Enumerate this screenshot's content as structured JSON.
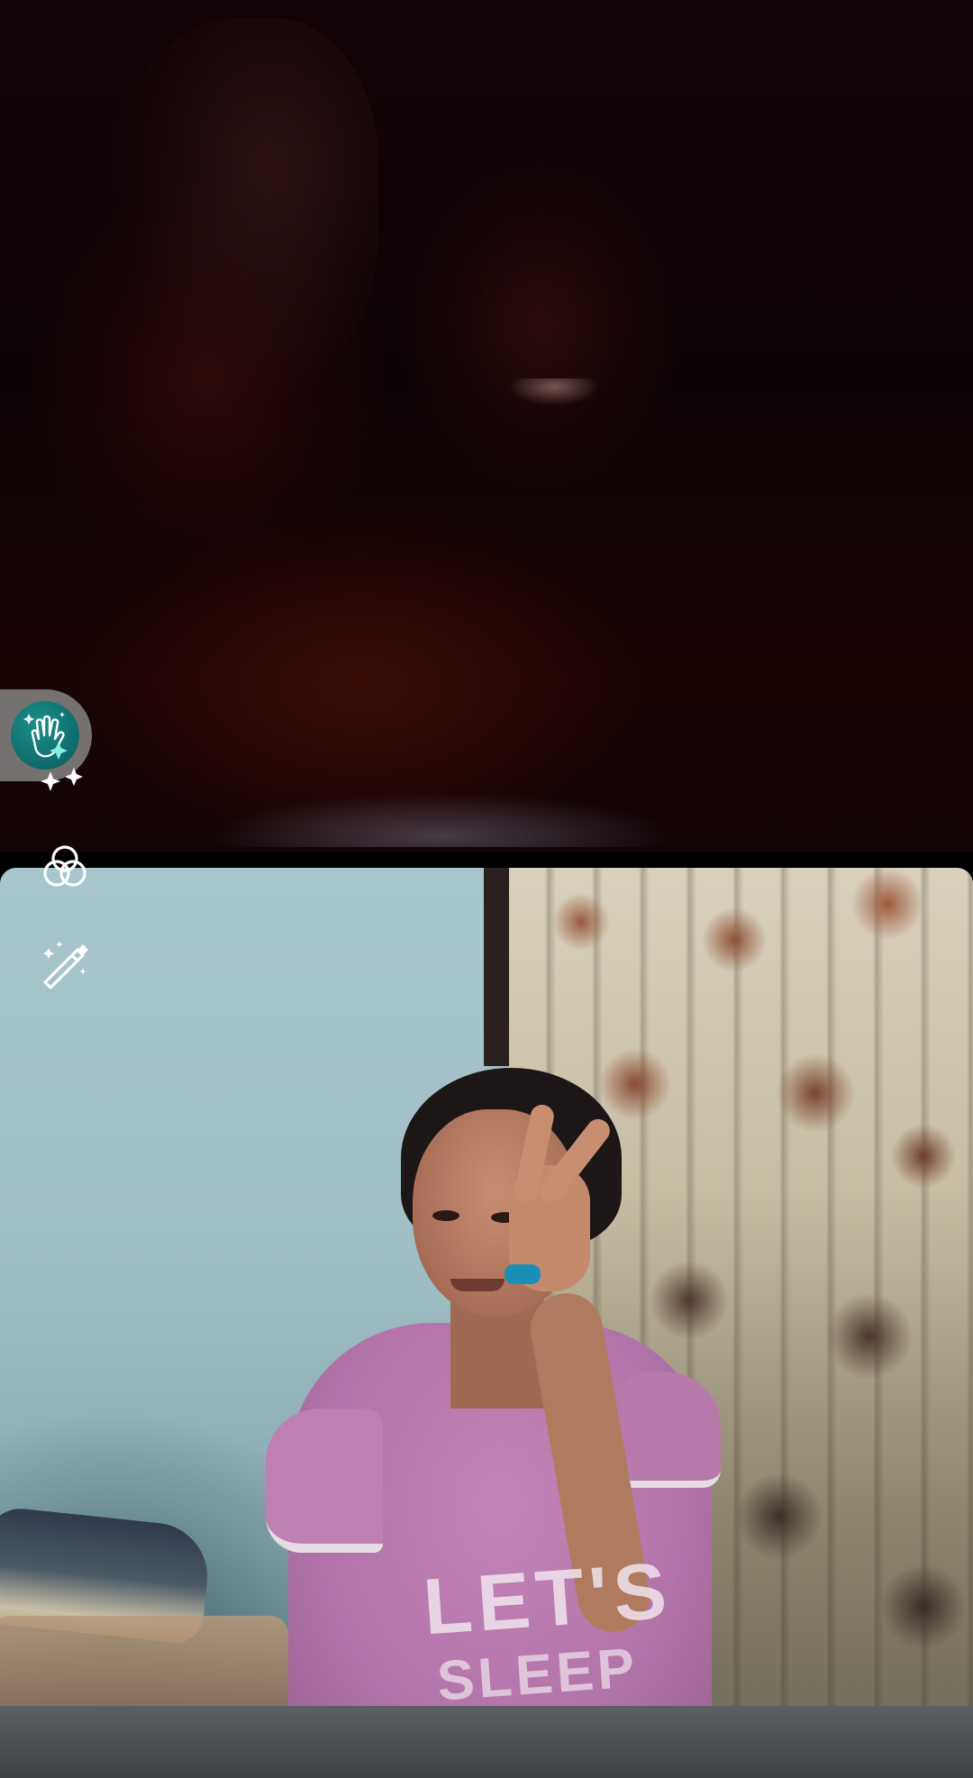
{
  "call": {
    "remote_feed": "remote-participant-video",
    "local_feed": "self-camera-video"
  },
  "self_view": {
    "shirt_print_line1": "LET'S",
    "shirt_print_line2": "SLEEP"
  },
  "side_controls": [
    {
      "name": "wave-effect",
      "icon": "waving-hand-sparkle-icon"
    },
    {
      "name": "filters",
      "icon": "three-circles-icon"
    },
    {
      "name": "touch-up",
      "icon": "magic-wand-icon"
    }
  ],
  "colors": {
    "wave_accent": "#0e6b6a",
    "wave_pill_bg": "#969696",
    "icon_color": "#ffffff",
    "nail_color": "#1a8fb8"
  }
}
